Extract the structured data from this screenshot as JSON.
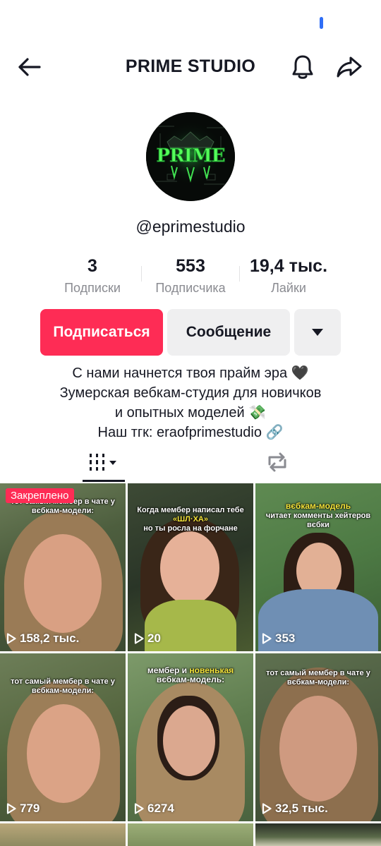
{
  "header": {
    "title": "PRIME STUDIO"
  },
  "profile": {
    "avatar_text": "PRIME",
    "username": "@eprimestudio"
  },
  "stats": [
    {
      "value": "3",
      "label": "Подписки"
    },
    {
      "value": "553",
      "label": "Подписчика"
    },
    {
      "value": "19,4 тыс.",
      "label": "Лайки"
    }
  ],
  "actions": {
    "follow_label": "Подписаться",
    "message_label": "Сообщение"
  },
  "bio": {
    "line1": "С нами начнется твоя прайм эра 🖤",
    "line2": "Зумерская вебкам-студия для новичков",
    "line3": "и опытных моделей 💸",
    "line4": "Наш тгк: eraofprimestudio 🔗"
  },
  "tabs": [
    {
      "name": "videos-grid-icon",
      "selected": true
    },
    {
      "name": "reposts-icon",
      "selected": false
    }
  ],
  "videos": [
    {
      "pinned_label": "Закреплено",
      "caption": "тот самый мембер в чате у вєбкам-модели:",
      "views": "158,2 тыс."
    },
    {
      "caption_a": "Когда мембер написал тебе",
      "caption_hl": "«ШЛ·ХА»",
      "caption_b": "но ты росла на форчане",
      "views": "20"
    },
    {
      "caption_hl": "вєбкам-модель",
      "caption_b": "читает комменты хейтеров вєбки",
      "views": "353"
    },
    {
      "caption": "тот самый мембер в чате у вєбкам-модели:",
      "views": "779"
    },
    {
      "caption_a": "мембер и",
      "caption_hl": "новенькая",
      "caption_b": "вєбкам-модель:",
      "views": "6274"
    },
    {
      "caption": "тот самый мембер в чате у вєбкам-модели:",
      "views": "32,5 тыс."
    }
  ],
  "colors": {
    "accent": "#fe2c55",
    "secondary_button": "#efeff0",
    "muted_text": "#8a8b91",
    "status_pill": "#2f6ef6"
  }
}
